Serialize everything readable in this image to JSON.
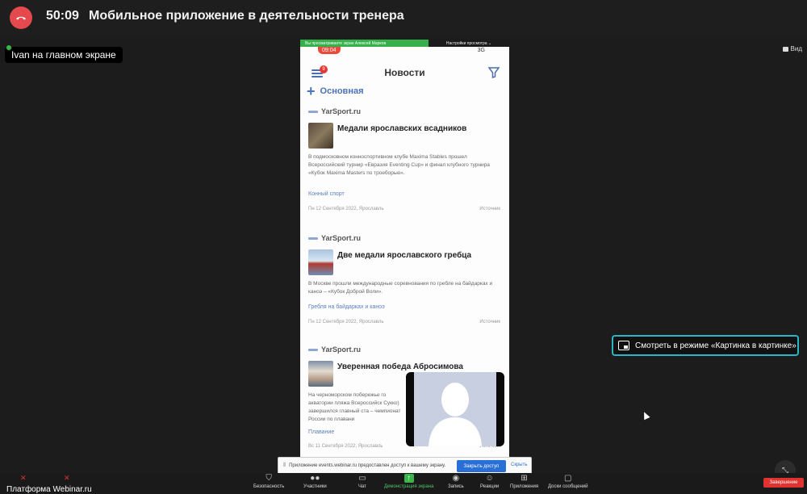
{
  "topbar": {
    "timer": "50:09",
    "title": "Мобильное приложение в деятельности тренера"
  },
  "presenter": {
    "label": "Ivan на главном экране",
    "view_label": "Вид"
  },
  "share": {
    "banner": "Вы просматриваете экран Алексей Марков",
    "options": "Настройки просмотра ⌄"
  },
  "phone": {
    "time": "09:04",
    "signal": "3G",
    "badge": "9",
    "header": "Новости",
    "main_category": "Основная",
    "cards": [
      {
        "source": "YarSport.ru",
        "headline": "Медали ярославских всадников",
        "description": "В подмосковном конноспортивном клубе Maxima Stables прошел Всероссийский турнир «Евразия Eventing Cup» и финал клубного турнира «Кубок Maxima Masters по троеборью».",
        "category": "Конный спорт",
        "date": "Пн 12 Сентября 2022, Ярославль",
        "sources_link": "Источник"
      },
      {
        "source": "YarSport.ru",
        "headline": "Две медали ярославского гребца",
        "description": "В Москве прошли международные соревнования по гребле на байдарках и каноэ – «Кубок Доброй Воли».",
        "category": "Гребля на байдарках и каноэ",
        "date": "Пн 12 Сентября 2022, Ярославль",
        "sources_link": "Источник"
      },
      {
        "source": "YarSport.ru",
        "headline": "Уверенная победа Абросимова",
        "description": "На черноморском побережье го акватории пляжа Всероссийск Сукко) завершился главный ста – чемпионат России по плавани",
        "category": "Плавание",
        "date": "Вс 11 Сентября 2022, Ярославль",
        "sources_link": "Источник"
      }
    ]
  },
  "notice": {
    "text": "Приложение events.webinar.ru предоставлен доступ к вашему экрану.",
    "stop_label": "Закрыть доступ",
    "hide_label": "Скрыть"
  },
  "pip": {
    "label": "Смотреть в режиме «Картинка в картинке»"
  },
  "toolbar": {
    "platform": "Платформа Webinar.ru",
    "items": [
      {
        "label": "Безопасность",
        "icon": "shield-icon"
      },
      {
        "label": "Участники",
        "icon": "people-icon"
      },
      {
        "label": "Чат",
        "icon": "chat-icon"
      },
      {
        "label": "Демонстрация экрана",
        "icon": "share-icon"
      },
      {
        "label": "Запись",
        "icon": "record-icon"
      },
      {
        "label": "Реакции",
        "icon": "reaction-icon"
      },
      {
        "label": "Приложения",
        "icon": "apps-icon"
      },
      {
        "label": "Доски сообщений",
        "icon": "whiteboard-icon"
      }
    ],
    "end_label": "Завершение"
  },
  "colors": {
    "end_call": "#e5484d",
    "share_green": "#35b04b",
    "pip_border": "#2bb6c7",
    "link_blue": "#4b73b8"
  }
}
